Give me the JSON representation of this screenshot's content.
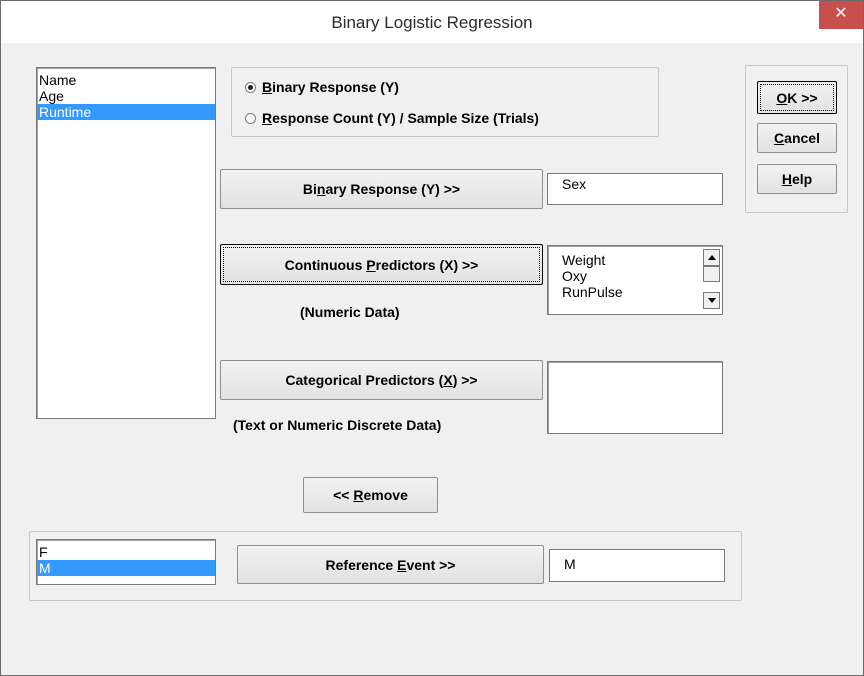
{
  "window": {
    "title": "Binary Logistic Regression",
    "close_glyph": "✕"
  },
  "variables_list": [
    "Name",
    "Age",
    "Runtime"
  ],
  "response_type": {
    "binary_prefix": "",
    "binary_key": "B",
    "binary_rest": "inary Response (Y)",
    "count_prefix": "",
    "count_key": "R",
    "count_rest": "esponse Count (Y) / Sample Size (Trials)",
    "selected": "binary"
  },
  "actions": {
    "ok_key": "O",
    "ok_rest": "K >>",
    "cancel_key": "C",
    "cancel_rest": "ancel",
    "help_key": "H",
    "help_rest": "elp"
  },
  "binary_response": {
    "button_prefix": "Bi",
    "button_key": "n",
    "button_rest": "ary Response (Y) >>",
    "value": "Sex"
  },
  "continuous_predictors": {
    "button_prefix": "Continuous ",
    "button_key": "P",
    "button_rest": "redictors (X) >>",
    "note": "(Numeric Data)",
    "items": [
      "Weight",
      "Oxy",
      "RunPulse"
    ]
  },
  "categorical_predictors": {
    "button_prefix": "Categorical Predictors (",
    "button_key": "X",
    "button_rest": ") >>",
    "note": "(Text or Numeric Discrete Data)"
  },
  "remove": {
    "prefix": "<< ",
    "key": "R",
    "rest": "emove"
  },
  "reference_event": {
    "levels": [
      "F",
      "M"
    ],
    "button_prefix": "Reference ",
    "button_key": "E",
    "button_rest": "vent >>",
    "value": "M"
  }
}
